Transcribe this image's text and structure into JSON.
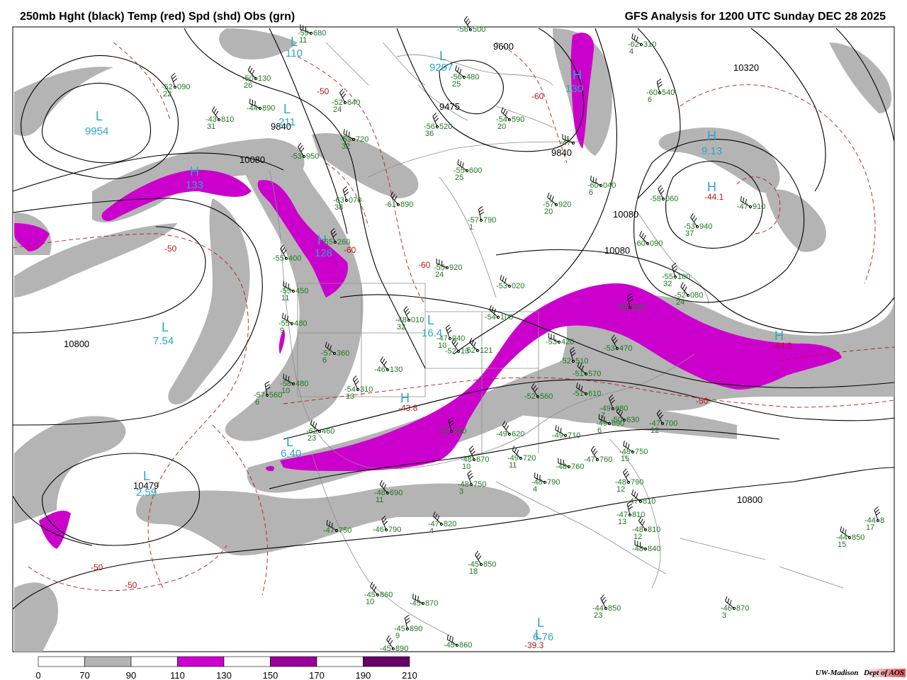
{
  "title_left": "250mb Hght (black) Temp (red) Spd (shd) Obs (grn)",
  "title_right": "GFS Analysis for 1200 UTC Sunday  DEC 28 2025",
  "legend": {
    "labels": [
      "0",
      "70",
      "90",
      "110",
      "130",
      "150",
      "170",
      "190",
      "210"
    ],
    "colors": [
      "#ffffff",
      "#b4b4b4",
      "#ffffff",
      "#cc00cc",
      "#ffffff",
      "#990099",
      "#ffffff",
      "#660066"
    ]
  },
  "credit": {
    "org": "UW-Madison",
    "dept": "Dept of AOS"
  },
  "height_labels": [
    {
      "t": "10080"
    },
    {
      "t": "10800"
    },
    {
      "t": "9840"
    },
    {
      "t": "9600"
    },
    {
      "t": "9475"
    },
    {
      "t": "10320"
    },
    {
      "t": "10080"
    },
    {
      "t": "10080"
    },
    {
      "t": "9840"
    },
    {
      "t": "10479"
    },
    {
      "t": "10800"
    }
  ],
  "temp_labels": [
    {
      "t": "-50"
    },
    {
      "t": "-60"
    },
    {
      "t": "-50"
    },
    {
      "t": "-60"
    },
    {
      "t": "-50"
    },
    {
      "t": "-50"
    },
    {
      "t": "-50"
    },
    {
      "t": "-60"
    }
  ],
  "centers": [
    {
      "s": "L",
      "v": "9954"
    },
    {
      "s": "H",
      "v": "133"
    },
    {
      "s": "L",
      "v": "211"
    },
    {
      "s": "L",
      "v": "110"
    },
    {
      "s": "L",
      "v": "9297"
    },
    {
      "s": "H",
      "v": "130"
    },
    {
      "s": "L",
      "v": "7.54"
    },
    {
      "s": "L",
      "v": "16.4"
    },
    {
      "s": "H",
      "v": "-43.8"
    },
    {
      "s": "H",
      "v": "128"
    },
    {
      "s": "H",
      "v": "9.13"
    },
    {
      "s": "H",
      "v": "-44.1"
    },
    {
      "s": "L",
      "v": "2.59"
    },
    {
      "s": "L",
      "v": "6.76"
    },
    {
      "s": "L",
      "v": "6.40"
    },
    {
      "s": "H",
      "v": "-44.3"
    },
    {
      "s": "L",
      "v": "-39.3"
    }
  ],
  "obs": [
    {
      "t": "-59",
      "h": "680",
      "w": "11"
    },
    {
      "t": "-56",
      "h": "500",
      "w": ""
    },
    {
      "t": "-62",
      "h": "310",
      "w": "4"
    },
    {
      "t": "-52",
      "h": "090",
      "w": "22"
    },
    {
      "t": "-50",
      "h": "130",
      "w": "26"
    },
    {
      "t": "-44",
      "h": "890",
      "w": ""
    },
    {
      "t": "-52",
      "h": "640",
      "w": "24"
    },
    {
      "t": "-56",
      "h": "480",
      "w": "25"
    },
    {
      "t": "-60",
      "h": "540",
      "w": "6"
    },
    {
      "t": "-43",
      "h": "810",
      "w": "31"
    },
    {
      "t": "-53",
      "h": "720",
      "w": "32"
    },
    {
      "t": "-56",
      "h": "520",
      "w": "36"
    },
    {
      "t": "-54",
      "h": "590",
      "w": "20"
    },
    {
      "t": "-47",
      "h": "",
      "w": ""
    },
    {
      "t": "-53",
      "h": "950",
      "w": ""
    },
    {
      "t": "-55",
      "h": "600",
      "w": "25"
    },
    {
      "t": "-63",
      "h": "070",
      "w": "38"
    },
    {
      "t": "-61",
      "h": "890",
      "w": ""
    },
    {
      "t": "-60",
      "h": "040",
      "w": "6"
    },
    {
      "t": "-58",
      "h": "060",
      "w": ""
    },
    {
      "t": "-57",
      "h": "920",
      "w": "20"
    },
    {
      "t": "-57",
      "h": "790",
      "w": "1"
    },
    {
      "t": "-53",
      "h": "940",
      "w": "37"
    },
    {
      "t": "-47",
      "h": "910",
      "w": ""
    },
    {
      "t": "-55",
      "h": "260",
      "w": ""
    },
    {
      "t": "-60",
      "h": "090",
      "w": ""
    },
    {
      "t": "-55",
      "h": "920",
      "w": "24"
    },
    {
      "t": "-55",
      "h": "400",
      "w": ""
    },
    {
      "t": "-53",
      "h": "020",
      "w": ""
    },
    {
      "t": "-55",
      "h": "100",
      "w": "32"
    },
    {
      "t": "-52",
      "h": "080",
      "w": "24"
    },
    {
      "t": "-55",
      "h": "450",
      "w": "11"
    },
    {
      "t": "-48",
      "h": "010",
      "w": "32"
    },
    {
      "t": "-54",
      "h": "100",
      "w": ""
    },
    {
      "t": "-55",
      "h": "320",
      "w": ""
    },
    {
      "t": "-52",
      "h": "13",
      "w": ""
    },
    {
      "t": "-55",
      "h": "480",
      "w": "9"
    },
    {
      "t": "-47",
      "h": "040",
      "w": "10"
    },
    {
      "t": "-52",
      "h": "121",
      "w": ""
    },
    {
      "t": "-53",
      "h": "420",
      "w": ""
    },
    {
      "t": "-53",
      "h": "470",
      "w": ""
    },
    {
      "t": "-57",
      "h": "360",
      "w": "6"
    },
    {
      "t": "-52",
      "h": "510",
      "w": ""
    },
    {
      "t": "-46",
      "h": "130",
      "w": ""
    },
    {
      "t": "-58",
      "h": "480",
      "w": "10"
    },
    {
      "t": "-54",
      "h": "310",
      "w": "13"
    },
    {
      "t": "-51",
      "h": "570",
      "w": ""
    },
    {
      "t": "-57",
      "h": "560",
      "w": "6"
    },
    {
      "t": "-52",
      "h": "560",
      "w": ""
    },
    {
      "t": "-51",
      "h": "610",
      "w": ""
    },
    {
      "t": "-49",
      "h": "680",
      "w": "7"
    },
    {
      "t": "-50",
      "h": "630",
      "w": ""
    },
    {
      "t": "-49",
      "h": "690",
      "w": "6"
    },
    {
      "t": "-47",
      "h": "700",
      "w": "12"
    },
    {
      "t": "-62",
      "h": "460",
      "w": "23"
    },
    {
      "t": "-51",
      "h": "590",
      "w": ""
    },
    {
      "t": "-49",
      "h": "620",
      "w": ""
    },
    {
      "t": "-49",
      "h": "710",
      "w": ""
    },
    {
      "t": "-48",
      "h": "670",
      "w": "10"
    },
    {
      "t": "-49",
      "h": "720",
      "w": "11"
    },
    {
      "t": "-48",
      "h": "760",
      "w": ""
    },
    {
      "t": "-47",
      "h": "760",
      "w": ""
    },
    {
      "t": "-48",
      "h": "750",
      "w": "15"
    },
    {
      "t": "-48",
      "h": "750",
      "w": "3"
    },
    {
      "t": "-48",
      "h": "690",
      "w": "11"
    },
    {
      "t": "-48",
      "h": "790",
      "w": "4"
    },
    {
      "t": "-48",
      "h": "790",
      "w": "12"
    },
    {
      "t": "-47",
      "h": "810",
      "w": ""
    },
    {
      "t": "-47",
      "h": "810",
      "w": "13"
    },
    {
      "t": "-48",
      "h": "810",
      "w": "12"
    },
    {
      "t": "-47",
      "h": "750",
      "w": ""
    },
    {
      "t": "-46",
      "h": "790",
      "w": ""
    },
    {
      "t": "-47",
      "h": "820",
      "w": "4"
    },
    {
      "t": "-48",
      "h": "840",
      "w": ""
    },
    {
      "t": "-45",
      "h": "850",
      "w": "18"
    },
    {
      "t": "-44",
      "h": "850",
      "w": "15"
    },
    {
      "t": "-44",
      "h": "8",
      "w": "17"
    },
    {
      "t": "-45",
      "h": "860",
      "w": "10"
    },
    {
      "t": "-45",
      "h": "870",
      "w": ""
    },
    {
      "t": "-44",
      "h": "850",
      "w": "23"
    },
    {
      "t": "-46",
      "h": "870",
      "w": "3"
    },
    {
      "t": "-45",
      "h": "890",
      "w": "9"
    },
    {
      "t": "-45",
      "h": "890",
      "w": ""
    },
    {
      "t": "-45",
      "h": "860",
      "w": ""
    }
  ]
}
